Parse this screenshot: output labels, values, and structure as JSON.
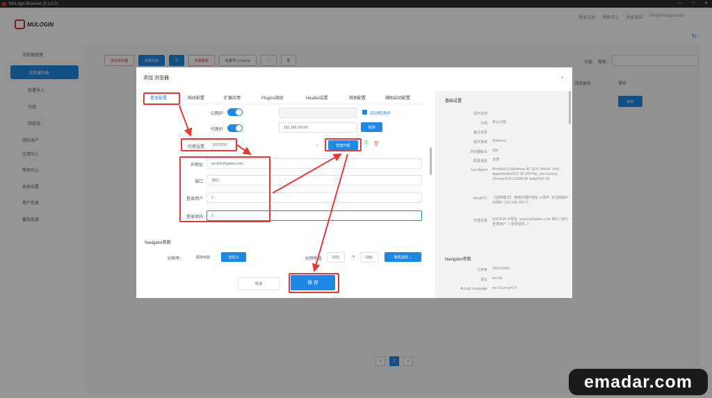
{
  "app": {
    "title": "MuLogin Browser  (3.1.0.2)",
    "logo_text": "MULOGIN",
    "window_controls": [
      "—",
      "□",
      "✕"
    ]
  },
  "header": {
    "links": [
      "登录记录",
      "帮助中心",
      "消息通知",
      "info@mulogin.com"
    ]
  },
  "sidebar": {
    "items": [
      {
        "label": "浏览器管理",
        "sub": false
      },
      {
        "label": "浏览器列表",
        "sub": true,
        "active": true
      },
      {
        "label": "批量导入",
        "sub": true
      },
      {
        "label": "分组",
        "sub": true
      },
      {
        "label": "回收站",
        "sub": true
      },
      {
        "label": "团队账户",
        "sub": false
      },
      {
        "label": "应用中心",
        "sub": false
      },
      {
        "label": "帮助中心",
        "sub": false
      },
      {
        "label": "系统设置",
        "sub": false
      },
      {
        "label": "用户信息",
        "sub": false
      },
      {
        "label": "番茄加速",
        "sub": false
      }
    ]
  },
  "toolbar": {
    "buttons": [
      "添加浏览器",
      "批量启动",
      "Q",
      "批量删除",
      "批量导入Cookie",
      "···",
      "▥"
    ],
    "search_label1": "分组",
    "search_label2": "搜索:"
  },
  "table": {
    "col1": "浏览器名",
    "col2": "操作",
    "row_button": "启动"
  },
  "pager": {
    "prev": "‹",
    "page": "1",
    "next": "›"
  },
  "modal": {
    "title": "添加 浏览器",
    "close": "×",
    "tabs": [
      "基本配置",
      "指纹配置",
      "扩展应用",
      "Plugins指纹",
      "Header设置",
      "其他配置",
      "辅助启动配置"
    ],
    "public_ip_label": "公网IP:",
    "proxy_ip_label": "代理IP:",
    "proxy_ip_value": "192.168.100.69",
    "check_label": "启动检测IP",
    "detect_button": "检测",
    "proxy_setting_label": "代理设置",
    "proxy_type": "SOCKS5",
    "check_proxy_button": "检查代理",
    "ip_label": "IP地址",
    "ip_value": "accel.kyfygates.com",
    "port_label": "端口",
    "port_value": "3001",
    "user_label": "登录用户",
    "user_value": "1",
    "pass_label": "登录密码",
    "pass_value": "1",
    "navigator_section": "Navigator参数",
    "resolution_label": "分辨率:",
    "resolution_mode": "跟随电脑",
    "custom_button": "自定义",
    "resolution_label2": "分辨率值:",
    "width": "1920",
    "times": "x",
    "height": "1080",
    "random_button": "随机选择 ⌄",
    "cancel": "取消",
    "save": "保 存"
  },
  "summary": {
    "section_title": "基础设置",
    "rows": [
      {
        "k": "显示名称",
        "v": ""
      },
      {
        "k": "分组",
        "v": "默认分组"
      },
      {
        "k": "备注信息",
        "v": ""
      },
      {
        "k": "操作系统",
        "v": "Windows"
      },
      {
        "k": "浏览器版本",
        "v": "134"
      },
      {
        "k": "配置语言",
        "v": "全部"
      },
      {
        "k": "UserAgent",
        "v": "Mozilla/5.0 (Windows NT 10.0; Win64; x64) AppleWebKit/537.36 (KHTML, like Gecko) Chrome/134.0.6998.88 Safari/537.36"
      },
      {
        "k": "WebRTC",
        "v": "【替换模式】 使用代理IP地址 公网IP: 无法获取IP 内网IP: 192.168.100.71"
      },
      {
        "k": "代理设置",
        "v": "SOCKS5 IP地址: accel.kyfygates.com 端口: 3001 登录用户: 1 登录密码: 1"
      }
    ],
    "nav_title": "Navigator参数",
    "nav_rows": [
      {
        "k": "分辨率",
        "v": "1920x1080"
      },
      {
        "k": "语言",
        "v": "en-US"
      },
      {
        "k": "Accept Language",
        "v": "en-US,en;q=0.9"
      }
    ]
  },
  "watermark": "emadar.com",
  "colors": {
    "accent": "#1e88e5",
    "annotation": "#e53935",
    "brand": "#c33333"
  }
}
